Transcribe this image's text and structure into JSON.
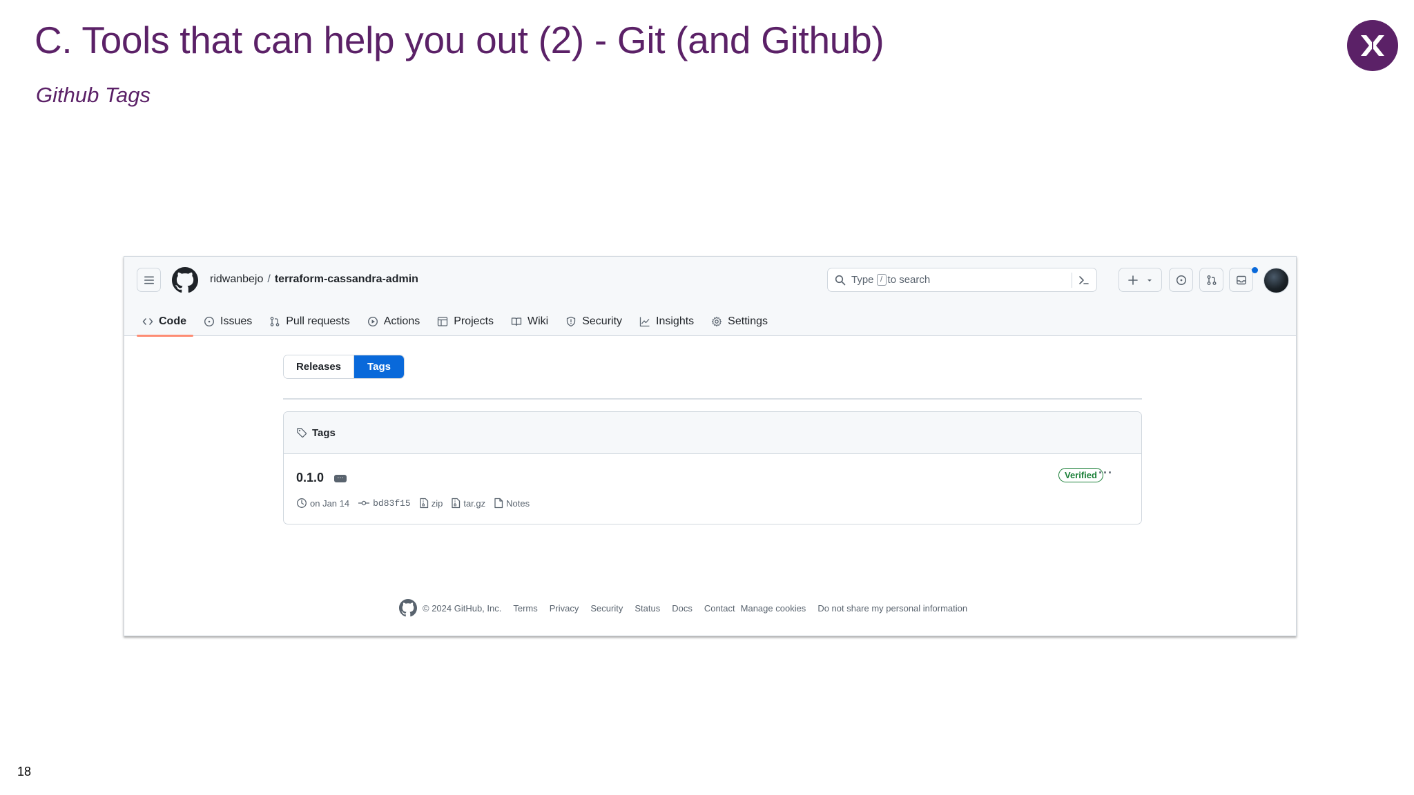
{
  "slide": {
    "title": "C. Tools that can help you out (2) - Git (and Github)",
    "subtitle": "Github Tags",
    "page_number": "18",
    "accent_color": "#5b2167"
  },
  "github": {
    "header": {
      "owner": "ridwanbejo",
      "separator": "/",
      "repo": "terraform-cassandra-admin",
      "search": {
        "prefix": "Type",
        "key": "/",
        "suffix": "to search"
      }
    },
    "tabs": [
      {
        "label": "Code",
        "icon": "code-icon",
        "selected": true
      },
      {
        "label": "Issues",
        "icon": "issue-icon"
      },
      {
        "label": "Pull requests",
        "icon": "pull-request-icon"
      },
      {
        "label": "Actions",
        "icon": "play-icon"
      },
      {
        "label": "Projects",
        "icon": "table-icon"
      },
      {
        "label": "Wiki",
        "icon": "book-icon"
      },
      {
        "label": "Security",
        "icon": "shield-icon"
      },
      {
        "label": "Insights",
        "icon": "graph-icon"
      },
      {
        "label": "Settings",
        "icon": "gear-icon"
      }
    ],
    "toggle": {
      "releases": "Releases",
      "tags": "Tags",
      "selected": "Tags"
    },
    "tags_box": {
      "heading": "Tags",
      "tag": {
        "name": "0.1.0",
        "verified": "Verified",
        "date": "on Jan 14",
        "commit": "bd83f15",
        "zip": "zip",
        "targz": "tar.gz",
        "notes": "Notes"
      }
    },
    "footer": {
      "copyright": "© 2024 GitHub, Inc.",
      "links": [
        "Terms",
        "Privacy",
        "Security",
        "Status",
        "Docs",
        "Contact",
        "Manage cookies",
        "Do not share my personal information"
      ]
    },
    "colors": {
      "link_blue": "#0969da",
      "verified_green": "#1a7f37",
      "selected_underline": "#fd8c73"
    }
  }
}
